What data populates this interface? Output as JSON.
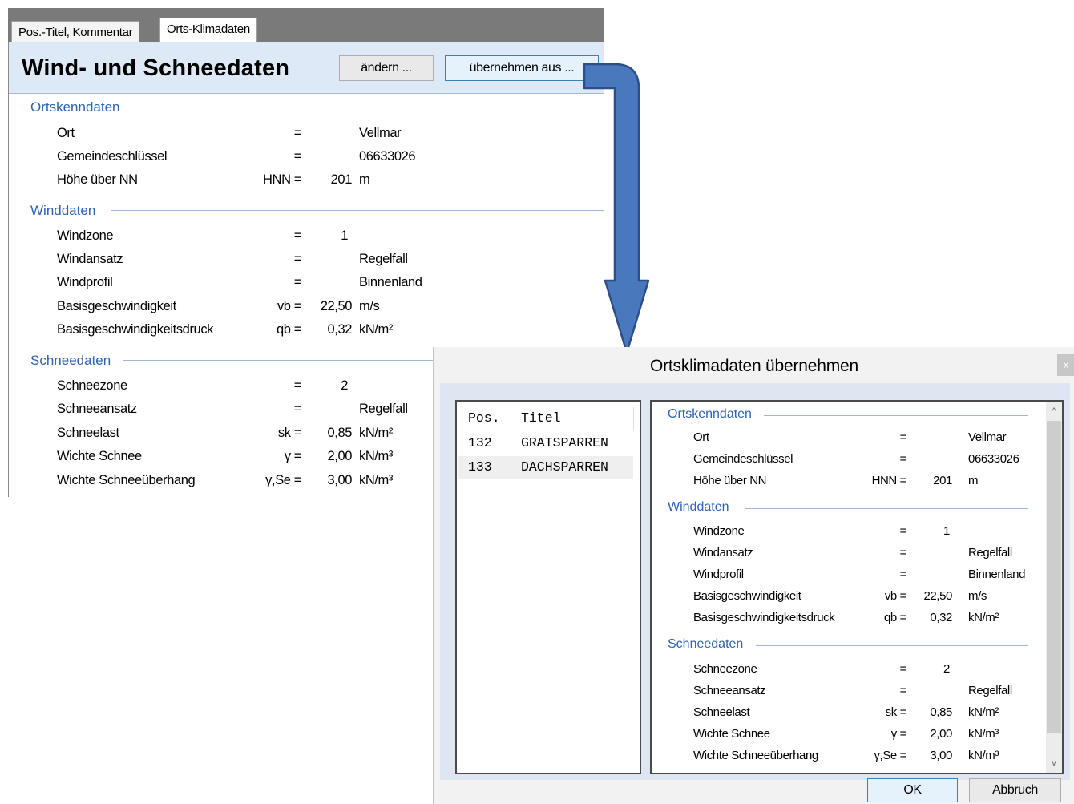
{
  "tabs": [
    {
      "label": "Pos.-Titel, Kommentar"
    },
    {
      "label": "Orts-Klimadaten",
      "active": true
    }
  ],
  "header": {
    "title": "Wind- und Schneedaten",
    "btn_aendern": "ändern ...",
    "btn_uebernehmen": "übernehmen aus ..."
  },
  "sections": {
    "orts": {
      "title": "Ortskenndaten",
      "rows": [
        {
          "label": "Ort",
          "sym": "=",
          "val": "",
          "unit": "Vellmar"
        },
        {
          "label": "Gemeindeschlüssel",
          "sym": "=",
          "val": "",
          "unit": "06633026"
        },
        {
          "label": "Höhe über NN",
          "sym": "HNN =",
          "val": "201",
          "unit": "m"
        }
      ]
    },
    "wind": {
      "title": "Winddaten",
      "rows": [
        {
          "label": "Windzone",
          "sym": "=",
          "val": "1",
          "unit": ""
        },
        {
          "label": "Windansatz",
          "sym": "=",
          "val": "",
          "unit": "Regelfall"
        },
        {
          "label": "Windprofil",
          "sym": "=",
          "val": "",
          "unit": "Binnenland"
        },
        {
          "label": "Basisgeschwindigkeit",
          "sym": "vb =",
          "val": "22,50",
          "unit": "m/s"
        },
        {
          "label": "Basisgeschwindigkeitsdruck",
          "sym": "qb =",
          "val": "0,32",
          "unit": "kN/m²"
        }
      ]
    },
    "schnee": {
      "title": "Schneedaten",
      "rows": [
        {
          "label": "Schneezone",
          "sym": "=",
          "val": "2",
          "unit": ""
        },
        {
          "label": "Schneeansatz",
          "sym": "=",
          "val": "",
          "unit": "Regelfall"
        },
        {
          "label": "Schneelast",
          "sym": "sk =",
          "val": "0,85",
          "unit": "kN/m²"
        },
        {
          "label": "Wichte Schnee",
          "sym": "γ =",
          "val": "2,00",
          "unit": "kN/m³"
        },
        {
          "label": "Wichte Schneeüberhang",
          "sym": "γ,Se =",
          "val": "3,00",
          "unit": "kN/m³"
        }
      ]
    }
  },
  "dialog": {
    "title": "Ortsklimadaten übernehmen",
    "close": "x",
    "list_header": {
      "pos": "Pos.",
      "titel": "Titel"
    },
    "list_items": [
      {
        "pos": "132",
        "titel": "GRATSPARREN"
      },
      {
        "pos": "133",
        "titel": "DACHSPARREN"
      }
    ],
    "ok": "OK",
    "abbruch": "Abbruch",
    "scroll_up": "^",
    "scroll_down": "v"
  },
  "colors": {
    "accent": "#2d63b2",
    "header_bg": "#dde9f7",
    "arrow": "#4a78bd"
  }
}
